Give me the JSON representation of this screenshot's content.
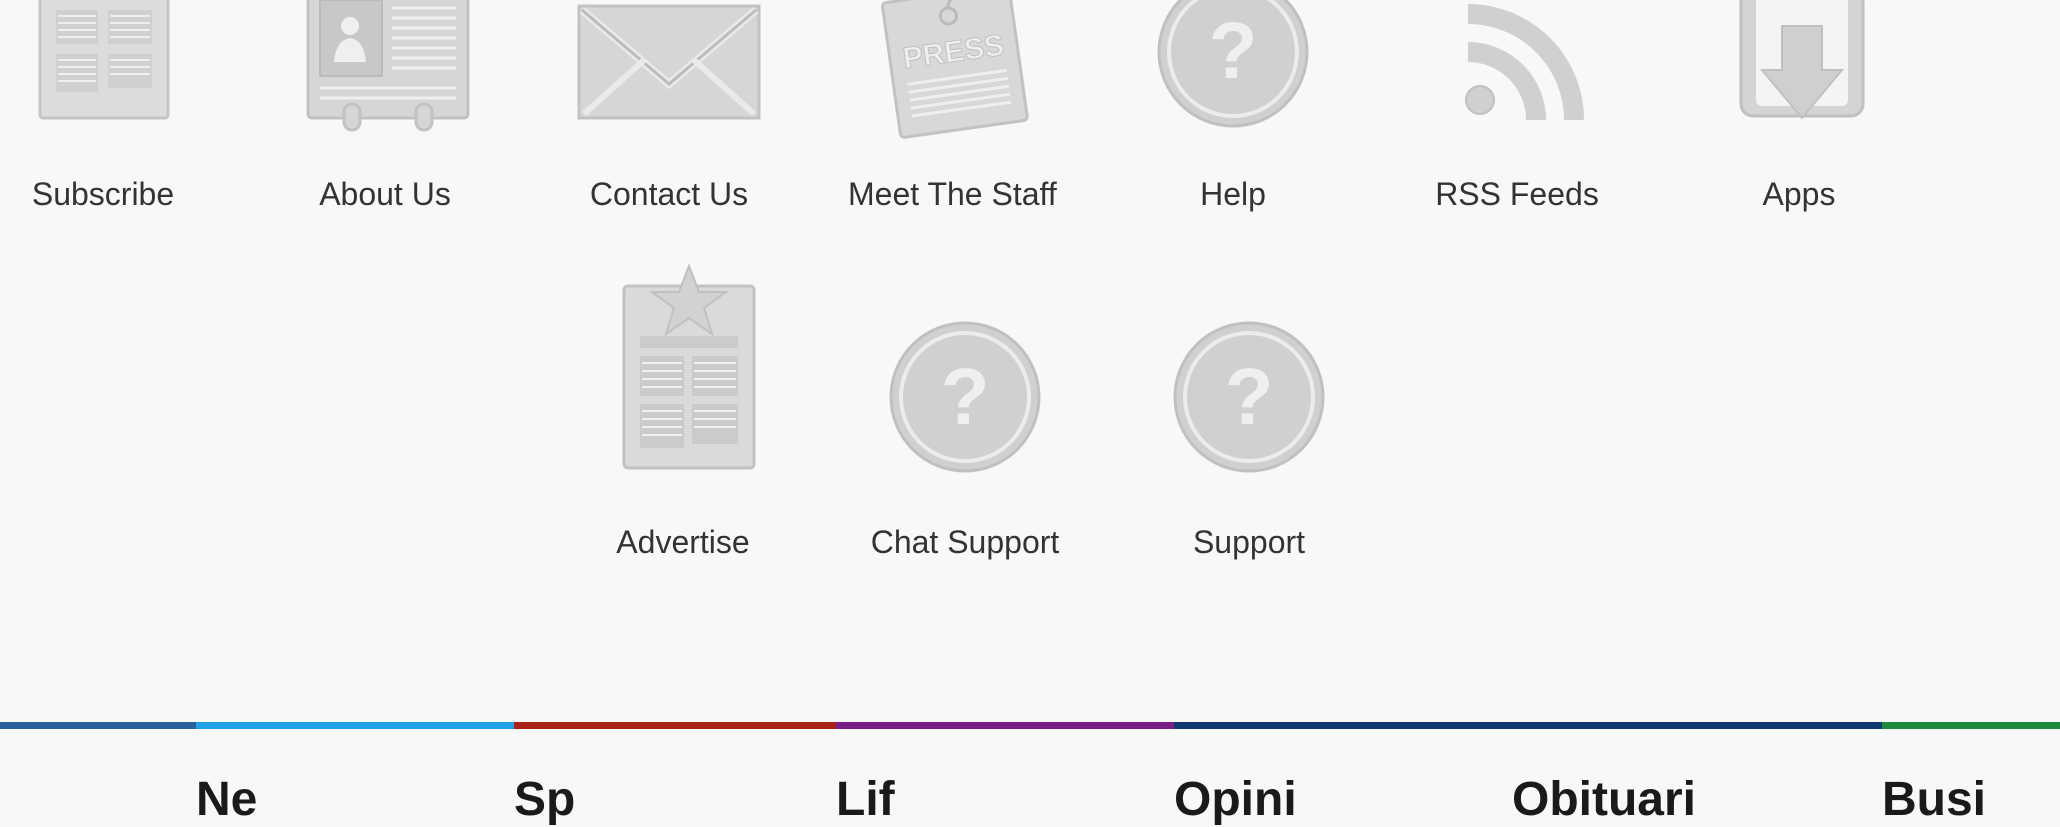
{
  "links_row1": [
    {
      "label": "Subscribe",
      "icon": "newspaper-icon"
    },
    {
      "label": "About Us",
      "icon": "id-card-icon"
    },
    {
      "label": "Contact Us",
      "icon": "envelope-icon"
    },
    {
      "label": "Meet The Staff",
      "icon": "press-badge-icon"
    },
    {
      "label": "Help",
      "icon": "question-icon"
    },
    {
      "label": "RSS Feeds",
      "icon": "rss-icon"
    },
    {
      "label": "Apps",
      "icon": "download-icon"
    }
  ],
  "links_row2": [
    {
      "label": "Advertise",
      "icon": "advertise-newspaper-icon"
    },
    {
      "label": "Chat Support",
      "icon": "question-icon"
    },
    {
      "label": "Support",
      "icon": "question-icon"
    }
  ],
  "press_text": "PRESS",
  "category_bar": {
    "colors": [
      "#2a5f9e",
      "#1ea1e8",
      "#a82218",
      "#7a1e8a",
      "#0e3a70",
      "#1e8a3e"
    ],
    "partial_labels": [
      "Ne",
      "Sp",
      "Lif",
      "Opini",
      "Obituari",
      "Busi"
    ]
  }
}
